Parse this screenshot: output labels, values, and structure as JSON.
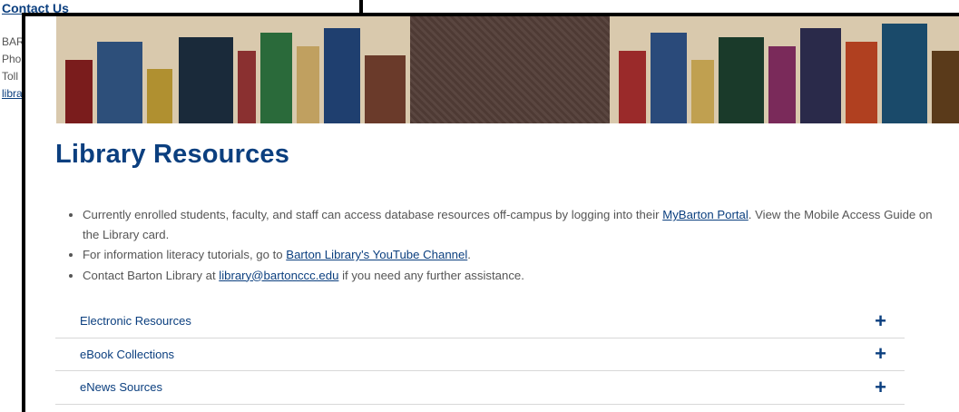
{
  "background": {
    "contact_title": "Contact Us",
    "lines": [
      "BAR",
      "Pho",
      "Toll",
      "libra"
    ]
  },
  "hero": {
    "alt": "Library bookshelves"
  },
  "title": "Library Resources",
  "bullets": [
    {
      "before": "Currently enrolled students, faculty, and staff can access database resources off-campus by logging into their ",
      "link": "MyBarton Portal",
      "after": ". View the Mobile Access Guide on the Library card."
    },
    {
      "before": "For information literacy tutorials, go to ",
      "link": "Barton Library's YouTube Channel",
      "after": "."
    },
    {
      "before": "Contact Barton Library at ",
      "link": "library@bartonccc.edu",
      "after": " if you need any further assistance."
    }
  ],
  "accordion": [
    {
      "label": "Electronic Resources",
      "icon": "plus-icon",
      "glyph": "+"
    },
    {
      "label": "eBook Collections",
      "icon": "plus-icon",
      "glyph": "+"
    },
    {
      "label": "eNews Sources",
      "icon": "plus-icon",
      "glyph": "+"
    }
  ],
  "colors": {
    "primary": "#0b3f7f",
    "text": "#555555",
    "divider": "#d8d8d8"
  }
}
